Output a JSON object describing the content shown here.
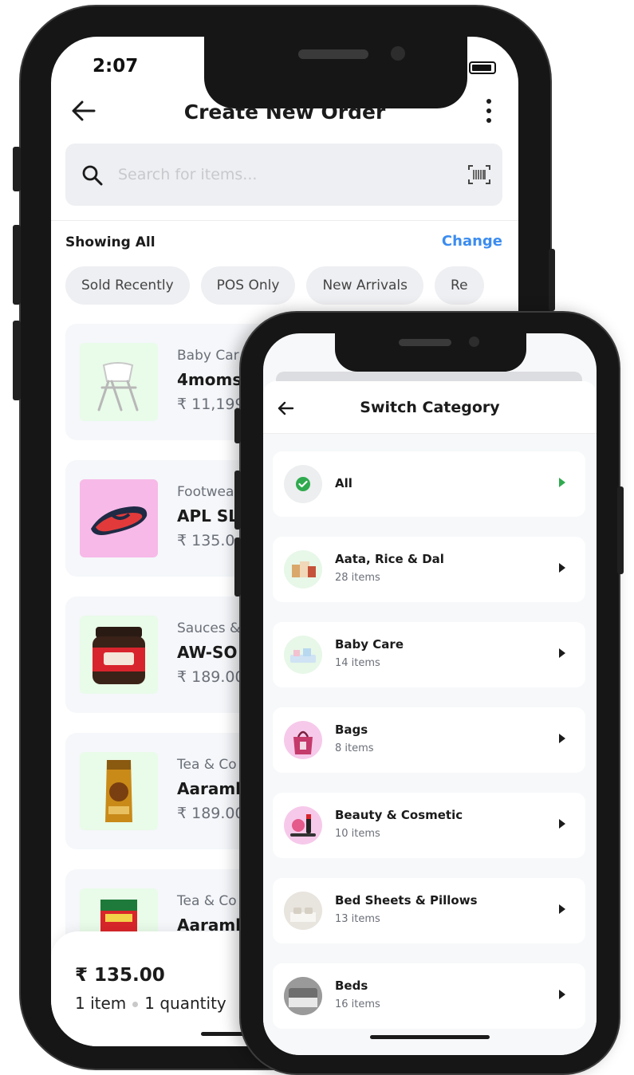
{
  "back_phone": {
    "status": {
      "time": "2:07"
    },
    "header": {
      "title": "Create New Order"
    },
    "search": {
      "placeholder": "Search for items..."
    },
    "filter": {
      "label": "Showing All",
      "action": "Change"
    },
    "chips": [
      "Sold Recently",
      "POS Only",
      "New Arrivals",
      "Re"
    ],
    "products": [
      {
        "category": "Baby Car",
        "name": "4moms",
        "price": "₹ 11,199.",
        "thumb_bg": "#e9fbe9"
      },
      {
        "category": "Footwea",
        "name": "APL SLI",
        "price": "₹ 135.0",
        "thumb_bg": "#f7b9e8"
      },
      {
        "category": "Sauces &",
        "name": "AW-SO",
        "price": "₹ 189.00",
        "thumb_bg": "#e9fbe9"
      },
      {
        "category": "Tea & Co",
        "name": "Aaramb",
        "price": "₹ 189.00",
        "thumb_bg": "#e9fbe9"
      },
      {
        "category": "Tea & Co",
        "name": "Aaramb",
        "price": "",
        "thumb_bg": "#e9fbe9"
      }
    ],
    "cart": {
      "total": "₹ 135.00",
      "items": "1 item",
      "quantity": "1 quantity"
    }
  },
  "front_phone": {
    "sheet": {
      "title": "Switch Category"
    },
    "categories": [
      {
        "name": "All",
        "count": "",
        "selected": true
      },
      {
        "name": "Aata, Rice & Dal",
        "count": "28 items",
        "selected": false
      },
      {
        "name": "Baby Care",
        "count": "14 items",
        "selected": false
      },
      {
        "name": "Bags",
        "count": "8 items",
        "selected": false
      },
      {
        "name": "Beauty & Cosmetic",
        "count": "10 items",
        "selected": false
      },
      {
        "name": "Bed Sheets & Pillows",
        "count": "13 items",
        "selected": false
      },
      {
        "name": "Beds",
        "count": "16 items",
        "selected": false
      }
    ]
  },
  "colors": {
    "accent_blue": "#3b8cf0",
    "success_green": "#2faa4f",
    "card_bg": "#f5f7fa",
    "chip_bg": "#eeeff2"
  },
  "icons": [
    "back-arrow-icon",
    "more-vertical-icon",
    "search-icon",
    "barcode-icon",
    "check-circle-icon",
    "chevron-right-icon",
    "wifi-icon",
    "battery-icon"
  ]
}
